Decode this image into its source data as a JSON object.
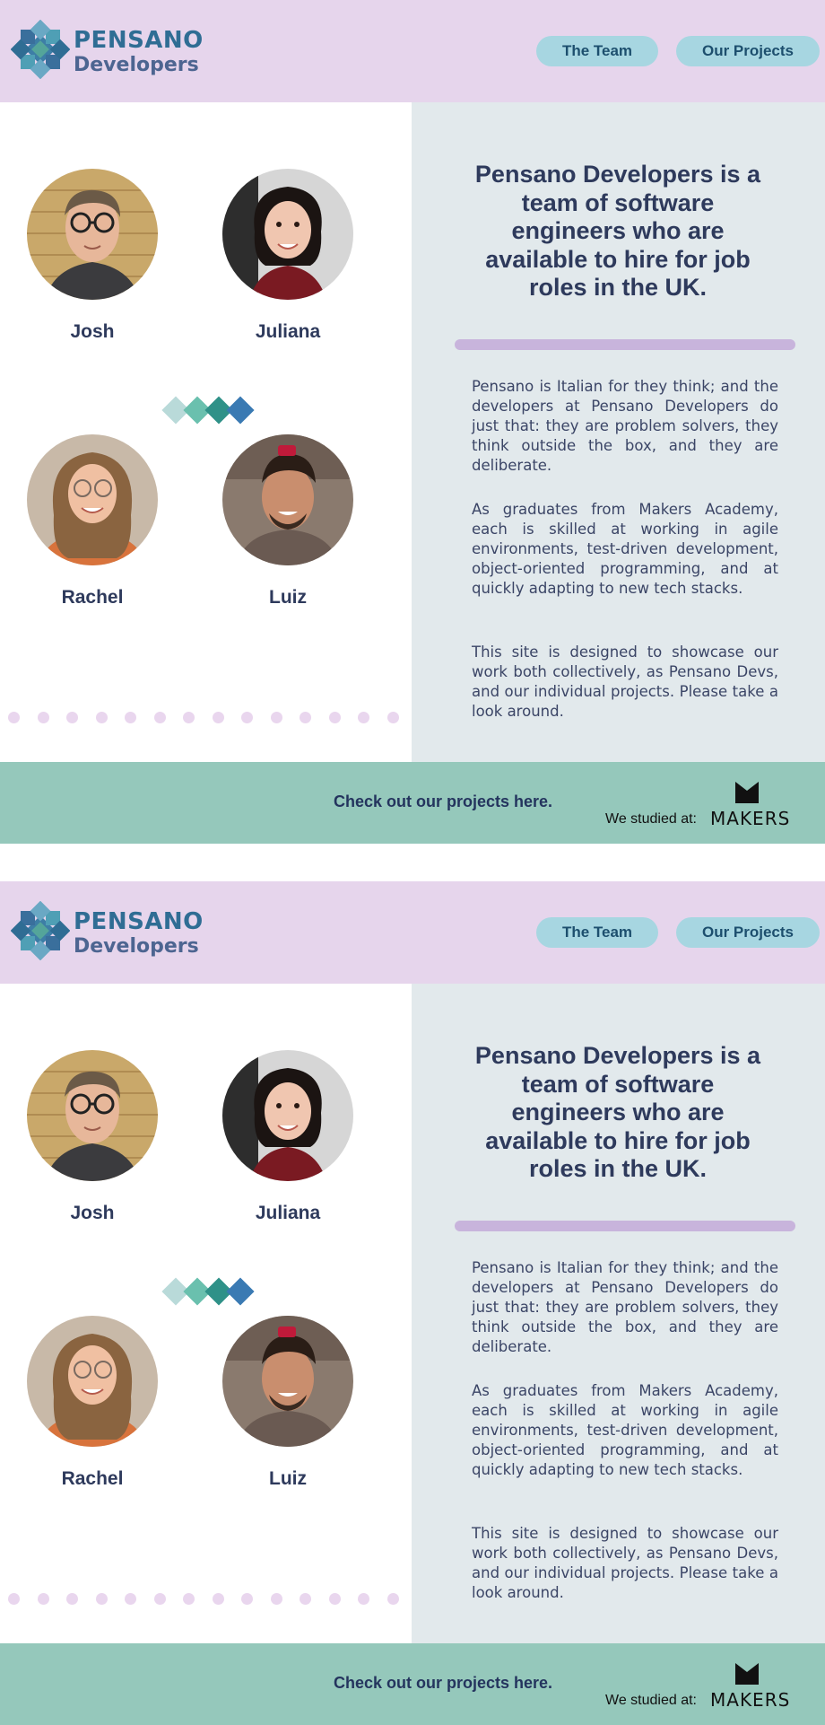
{
  "brand": {
    "name_top": "PENSANO",
    "name_bottom": "Developers"
  },
  "nav": {
    "team": "The Team",
    "projects": "Our Projects"
  },
  "team": [
    {
      "name": "Josh"
    },
    {
      "name": "Juliana"
    },
    {
      "name": "Rachel"
    },
    {
      "name": "Luiz"
    }
  ],
  "about": {
    "headline": "Pensano Developers is a team of software engineers who are available to hire for job roles in the UK.",
    "paragraphs": [
      "Pensano is Italian for they think; and the developers at Pensano Developers do just that: they are problem solvers, they think outside the box, and they are deliberate.",
      "As graduates from Makers Academy, each is skilled at working in agile environments, test-driven development, object-oriented programming, and at quickly adapting to new tech stacks.",
      "This site is designed to showcase our work both collectively, as Pensano Devs, and our individual projects. Please take a look around."
    ]
  },
  "footer": {
    "projects_link": "Check out our projects here.",
    "studied_label": "We studied at:",
    "school": "MAKERS"
  },
  "colors": {
    "header_bg": "#e6d5ec",
    "panel_bg": "#e2e9ec",
    "footer_bg": "#95c8bb",
    "nav_button": "#a7d6e1",
    "divider": "#c8b4dc",
    "text_dark": "#2e3a5c"
  },
  "icons": {
    "logo": "pensano-star-logo",
    "diamonds": "decorative-diamonds",
    "school_logo": "makers-logo"
  }
}
